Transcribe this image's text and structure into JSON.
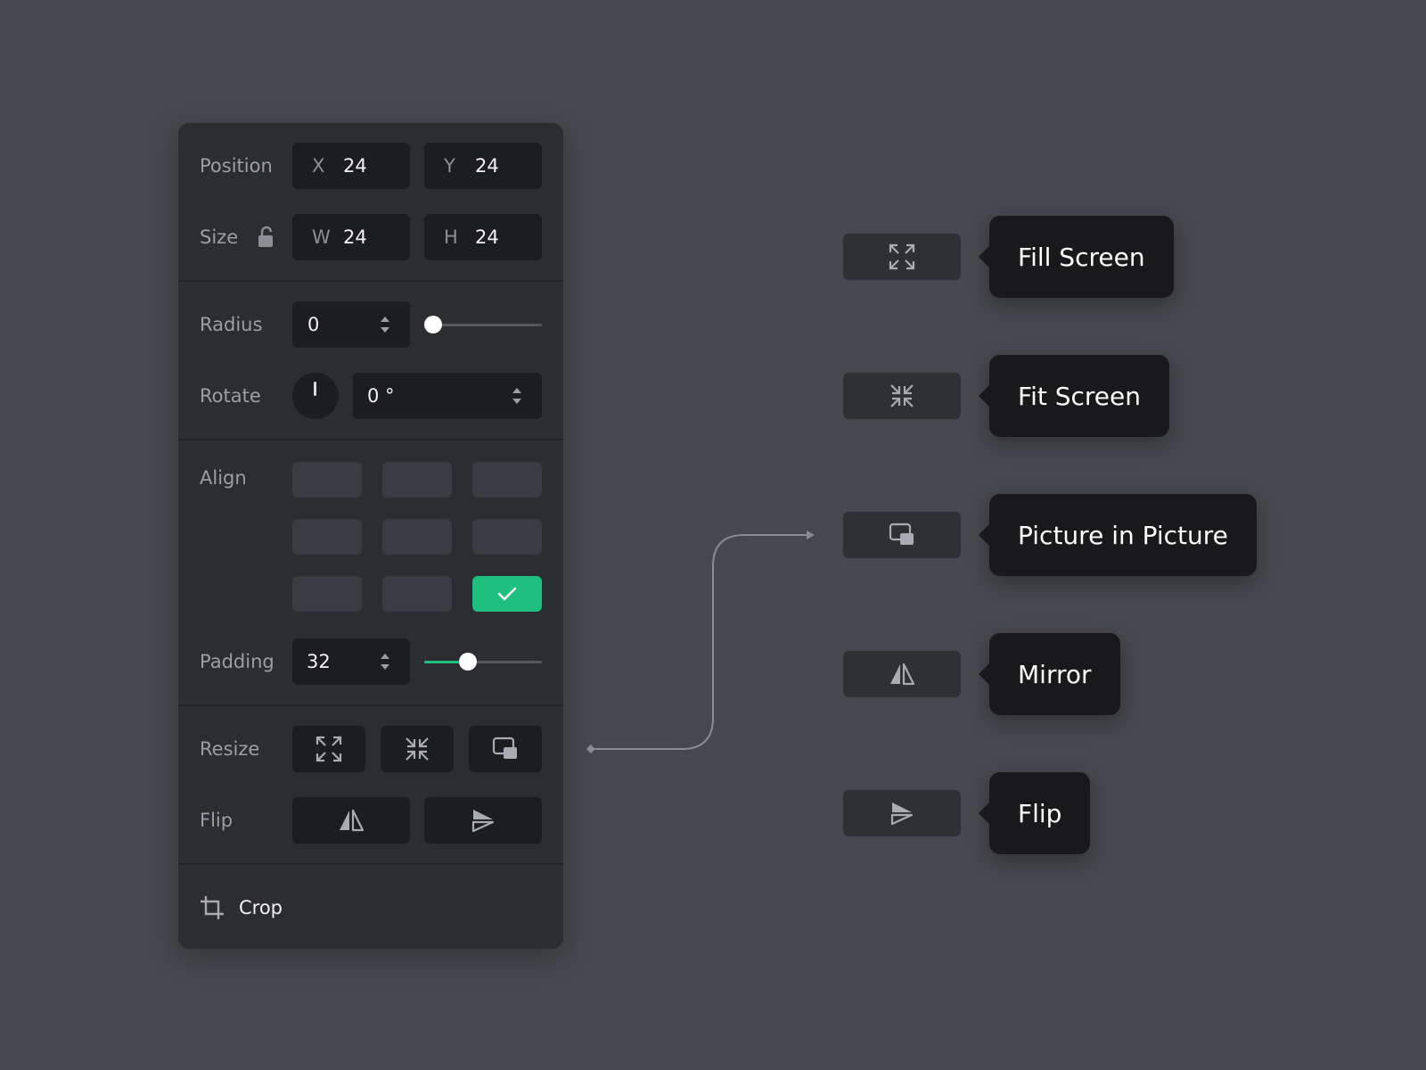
{
  "panel": {
    "position": {
      "label": "Position",
      "x_axis": "X",
      "x_value": "24",
      "y_axis": "Y",
      "y_value": "24"
    },
    "size": {
      "label": "Size",
      "w_axis": "W",
      "w_value": "24",
      "h_axis": "H",
      "h_value": "24",
      "lock_icon": "unlock-icon"
    },
    "radius": {
      "label": "Radius",
      "value": "0",
      "slider_fraction": 0.0
    },
    "rotate": {
      "label": "Rotate",
      "value": "0 °",
      "dial_icon": "rotation-dial-icon"
    },
    "align": {
      "label": "Align",
      "selected": "bottom-right"
    },
    "padding": {
      "label": "Padding",
      "value": "32",
      "slider_fraction": 0.37
    },
    "resize": {
      "label": "Resize",
      "icons": [
        "fill-screen-icon",
        "fit-screen-icon",
        "picture-in-picture-icon"
      ]
    },
    "flip": {
      "label": "Flip",
      "icons": [
        "mirror-icon",
        "flip-icon"
      ]
    },
    "crop": {
      "label": "Crop",
      "icon": "crop-icon"
    }
  },
  "tooltips": [
    {
      "label": "Fill Screen",
      "icon": "fill-screen-icon"
    },
    {
      "label": "Fit Screen",
      "icon": "fit-screen-icon"
    },
    {
      "label": "Picture in Picture",
      "icon": "picture-in-picture-icon"
    },
    {
      "label": "Mirror",
      "icon": "mirror-icon"
    },
    {
      "label": "Flip",
      "icon": "flip-icon"
    }
  ],
  "colors": {
    "background": "#46484d",
    "panel": "#2c2d31",
    "field": "#1c1d20",
    "accent": "#1fbf7d",
    "tooltip": "#19191b"
  }
}
